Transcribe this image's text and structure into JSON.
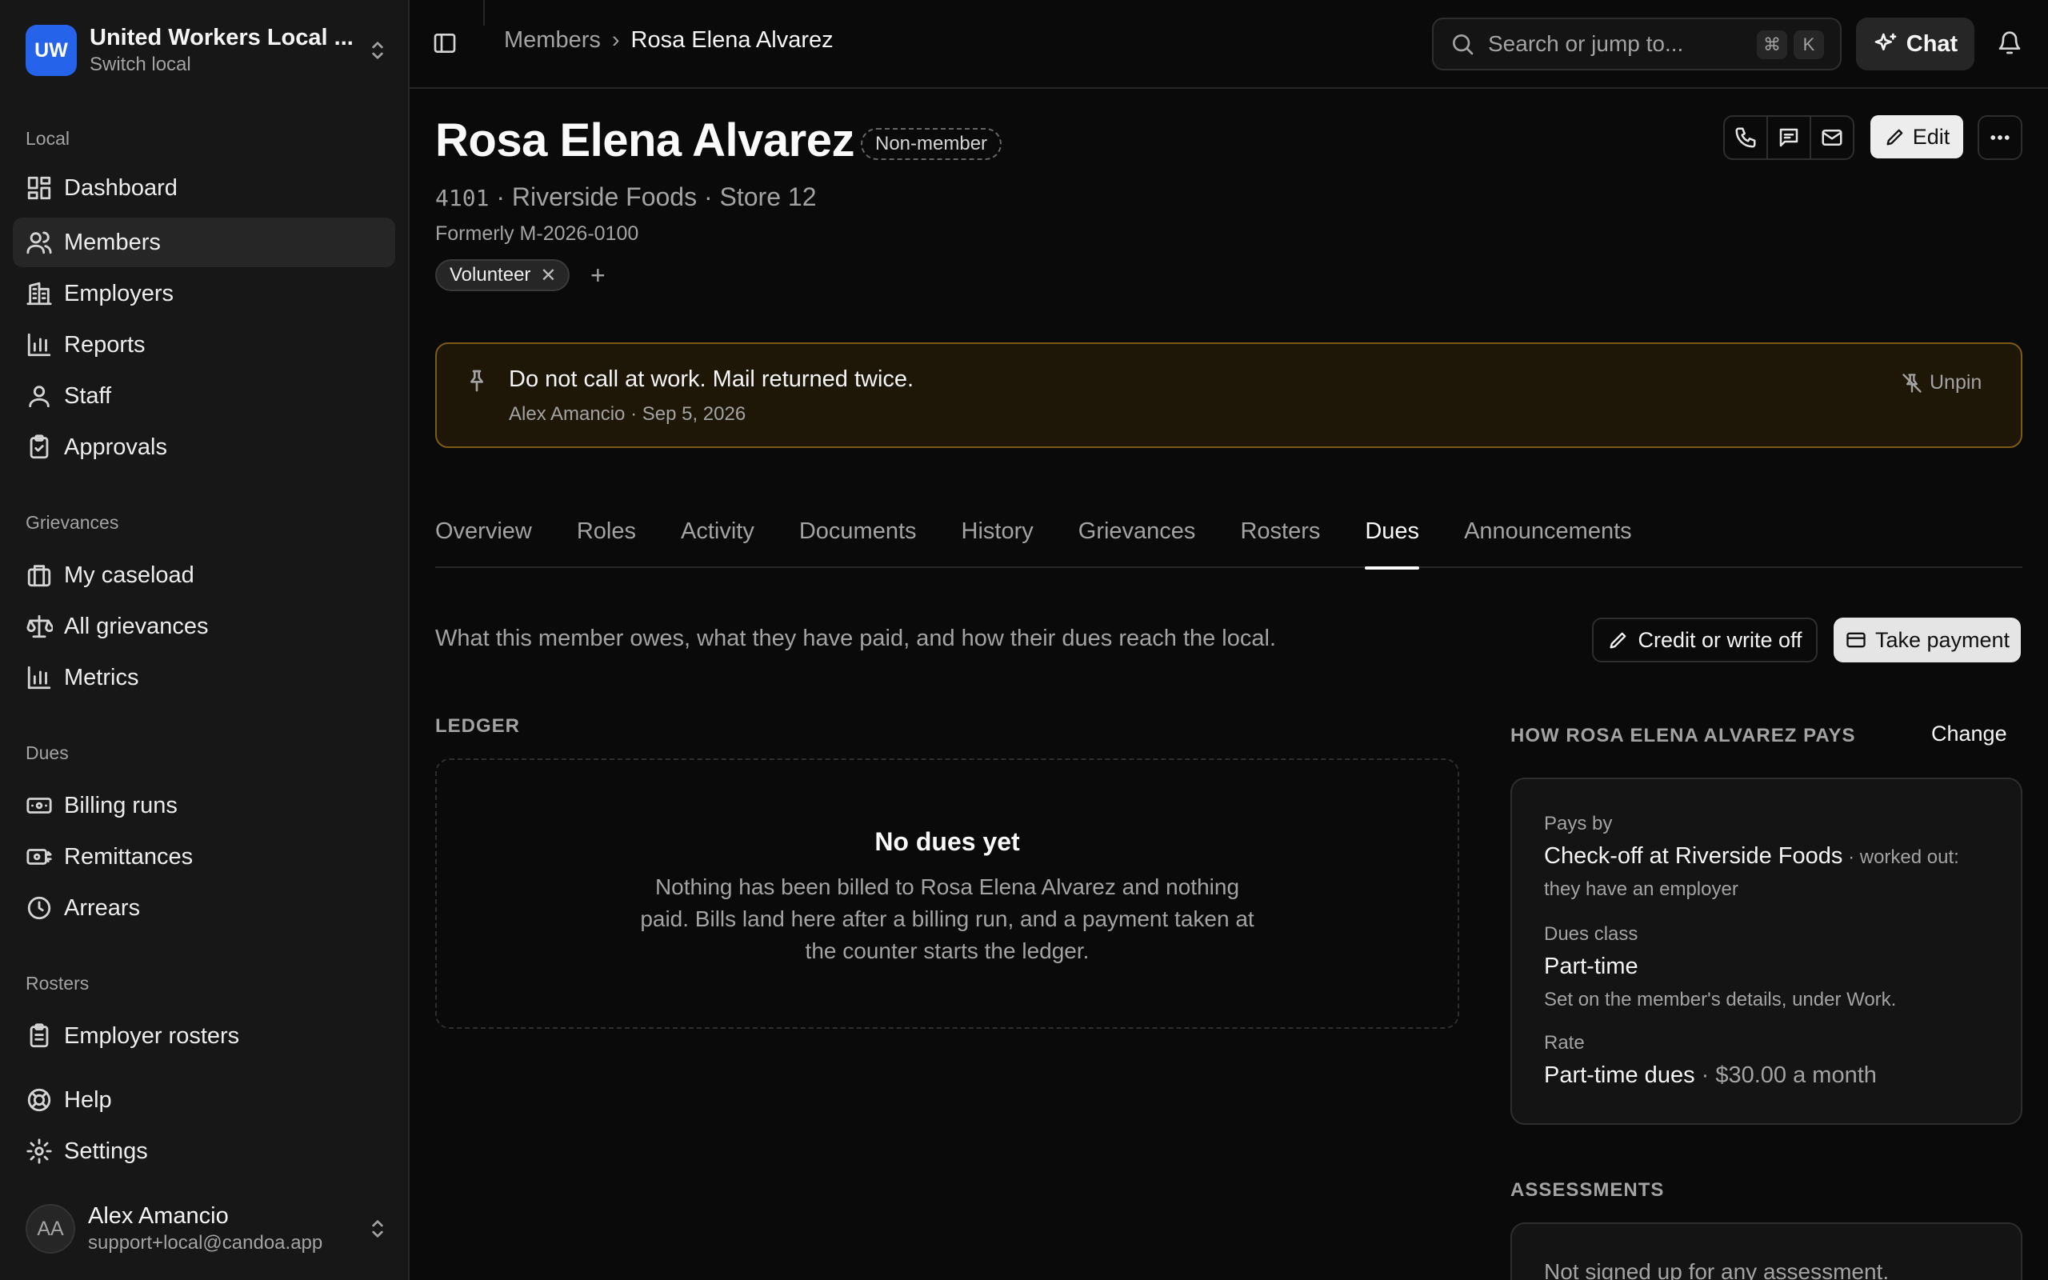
{
  "local": {
    "initials": "UW",
    "name": "United Workers Local ...",
    "subtitle": "Switch local"
  },
  "nav": {
    "local_label": "Local",
    "local_items": [
      "Dashboard",
      "Members",
      "Employers",
      "Reports",
      "Staff",
      "Approvals"
    ],
    "grievances_label": "Grievances",
    "grievances_items": [
      "My caseload",
      "All grievances",
      "Metrics"
    ],
    "dues_label": "Dues",
    "dues_items": [
      "Billing runs",
      "Remittances",
      "Arrears"
    ],
    "rosters_label": "Rosters",
    "rosters_items": [
      "Employer rosters"
    ],
    "footer_items": [
      "Help",
      "Settings"
    ]
  },
  "user": {
    "initials": "AA",
    "name": "Alex Amancio",
    "email": "support+local@candoa.app"
  },
  "breadcrumb": {
    "parent": "Members",
    "separator": "›",
    "current": "Rosa Elena Alvarez"
  },
  "search": {
    "placeholder": "Search or jump to...",
    "key1": "⌘",
    "key2": "K"
  },
  "chat": {
    "label": "Chat"
  },
  "member": {
    "name": "Rosa Elena Alvarez",
    "status": "Non-member",
    "number": "4101",
    "workplace": " · Riverside Foods · Store 12",
    "former_id": "Formerly M-2026-0100",
    "tags": [
      "Volunteer"
    ],
    "add_tag": "+",
    "edit_label": "Edit"
  },
  "pinned_note": {
    "text": "Do not call at work. Mail returned twice.",
    "meta": "Alex Amancio · Sep 5, 2026",
    "unpin_label": "Unpin"
  },
  "tabs": [
    "Overview",
    "Roles",
    "Activity",
    "Documents",
    "History",
    "Grievances",
    "Rosters",
    "Dues",
    "Announcements"
  ],
  "active_tab": "Dues",
  "dues": {
    "description": "What this member owes, what they have paid, and how their dues reach the local.",
    "credit_label": "Credit or write off",
    "payment_label": "Take payment",
    "ledger_label": "LEDGER",
    "empty_title": "No dues yet",
    "empty_body": "Nothing has been billed to Rosa Elena Alvarez and nothing paid. Bills land here after a billing run, and a payment taken at the counter starts the ledger.",
    "pays_label": "HOW ROSA ELENA ALVAREZ PAYS",
    "change_label": "Change",
    "pays_by_label": "Pays by",
    "pays_by_value": "Check-off at Riverside Foods",
    "pays_by_note": " · worked out:",
    "pays_by_note2": "they have an employer",
    "class_label": "Dues class",
    "class_value": "Part-time",
    "class_note": "Set on the member's details, under Work.",
    "rate_label": "Rate",
    "rate_value": "Part-time dues",
    "rate_amount": " · $30.00 a month",
    "assessments_label": "ASSESSMENTS",
    "assessments_empty": "Not signed up for any assessment."
  },
  "colors": {
    "accent": "#2563eb",
    "pinned_border": "#7c5a14",
    "pinned_bg": "#1e1708",
    "background": "#0a0a0a",
    "sidebar": "#171717"
  }
}
